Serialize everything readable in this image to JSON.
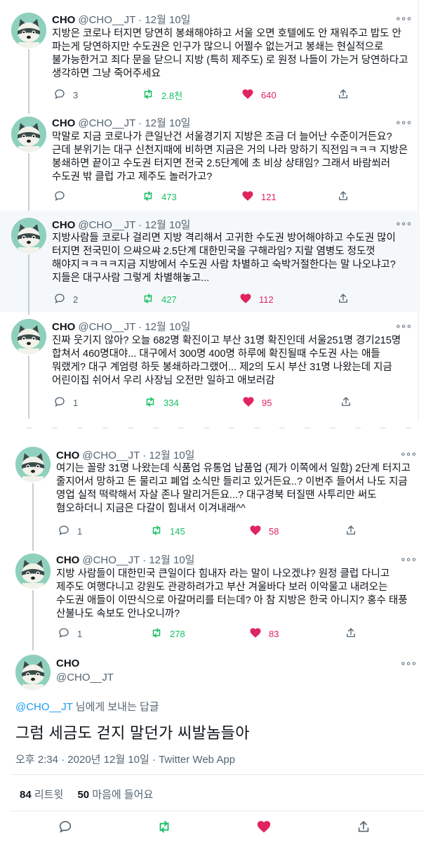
{
  "thread": [
    {
      "name": "CHO",
      "handle": "@CHO__JT",
      "date": "· 12월 10일",
      "text": "지방은 코로나 터지면 당연히 봉쇄해야하고 서울 오면 호텔에도 안 재워주고 밥도 안 파는게 당연하지만 수도권은 인구가 많으니 어쩔수 없는거고 봉쇄는 현실적으로 불가능한거고 죄다 문을 닫으니 지방 (특히 제주도) 로 원정 나들이 가는거 당연하다고 생각하면 그냥 죽어주세요",
      "replies": "3",
      "retweets": "2.8천",
      "likes": "640"
    },
    {
      "name": "CHO",
      "handle": "@CHO__JT",
      "date": "· 12월 10일",
      "text": "막말로 지금 코로나가 큰일난건 서울경기지 지방은 조금 더 늘어난 수준이거든요? 근데 분위기는 대구 신천지때에 비하면 지금은 거의 나라 망하기 직전임ㅋㅋㅋ 지방은 봉쇄하면 끝이고 수도권 터지면 전국 2.5단계에 초 비상 상태임? 그래서 바람쐬러 수도권 밖 클럽 가고 제주도 놀러가고?",
      "replies": "",
      "retweets": "473",
      "likes": "121"
    },
    {
      "name": "CHO",
      "handle": "@CHO__JT",
      "date": "· 12월 10일",
      "text": "지방사람들 코로나 걸리면 지방 격리해서 고귀한 수도권 방어해야하고 수도권 많이 터지면 전국민이 으쌰으쌰 2.5단계 대한민국을 구해라임? 지랄 염병도 정도껏 해야지ㅋㅋㅋㅋ지금 지방에서 수도권 사람 차별하고 숙박거절한다는 말 나오냐고? 지들은 대구사람 그렇게 차별해놓고...",
      "replies": "2",
      "retweets": "427",
      "likes": "112"
    },
    {
      "name": "CHO",
      "handle": "@CHO__JT",
      "date": "· 12월 10일",
      "text": "진짜 웃기지 않아? 오늘 682명 확진이고 부산 31명 확진인데 서울251명 경기215명 합쳐서 460명대야... 대구에서 300명 400명 하루에 확진될때 수도권 사는 애들 뭐랬게? 대구 계엄령 하듯 봉쇄하라그랬어... 제2의 도시 부산 31명 나왔는데 지금 어린이집 쉬어서 우리 사장님 오전만 일하고 애보러감",
      "replies": "1",
      "retweets": "334",
      "likes": "95"
    },
    {
      "name": "CHO",
      "handle": "@CHO__JT",
      "date": "· 12월 10일",
      "text": "여기는 꼴랑 31명 나왔는데 식품업 유통업 납품업 (제가 이쪽에서 일함) 2단계 터지고 줄지어서 망하고 돈 물리고 폐업 소식만 들리고 있거든요..? 이번주 들어서 나도 지금 영업 실적 떡락해서 자살 존나 말리거든요...? 대구경북 터질땐 사투리만 써도 혐오하더니 지금은 다갈이 힘내서 이겨내래^^",
      "replies": "1",
      "retweets": "145",
      "likes": "58"
    },
    {
      "name": "CHO",
      "handle": "@CHO__JT",
      "date": "· 12월 10일",
      "text": "지방 사람들이 대한민국 큰일이다 힘내자 라는 말이 나오겠냐? 원정 클럽 다니고 제주도 여행다니고 강원도 관광하려가고 부산 겨울바다 보러 이악물고 내려오는 수도권 애들이 이딴식으로 아갈머리를 터는데? 아 참 지방은 한국 아니지? 홍수 태풍 산불나도 속보도 안나오니까?",
      "replies": "1",
      "retweets": "278",
      "likes": "83"
    }
  ],
  "main": {
    "name": "CHO",
    "handle": "@CHO__JT",
    "reply_to_handle": "@CHO__JT",
    "reply_to_suffix": " 님에게 보내는 답글",
    "text": "그럼 세금도 걷지 말던가 씨발놈들아",
    "meta": "오후 2:34 · 2020년 12월 10일 · Twitter Web App",
    "retweets_count": "84",
    "retweets_label": "리트윗",
    "likes_count": "50",
    "likes_label": "마음에 들어요"
  },
  "more_glyph": "∘∘∘",
  "colors": {
    "retweet": "#17bf63",
    "like": "#e0245e",
    "link": "#1d9bf0",
    "muted": "#536471"
  }
}
